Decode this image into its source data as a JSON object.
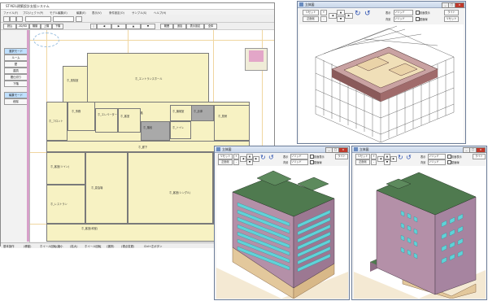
{
  "main": {
    "title": "ST-N2L建築設計支援システム",
    "menu": [
      "ファイル(F)",
      "プロジェクト(P)",
      "モデル編集(E)",
      "編集(E)",
      "表示(V)",
      "条件設定(O)",
      "サンプル(S)",
      "ヘルプ(H)"
    ],
    "toolbar2": [
      "読込",
      "2D/3D",
      "階層",
      "上階",
      "下階",
      "|",
      "◀",
      "▶",
      "▲",
      "▼",
      "範囲",
      "追加",
      "表示設定",
      "全体"
    ],
    "side_buttons": [
      "選択モード",
      "ルーム",
      "壁",
      "建具",
      "間仕切り",
      "下階",
      "編集モード",
      "削除"
    ],
    "status": [
      "基本操作",
      "(移動)",
      "ホイール回転(縮小",
      "(拡大)",
      "ホイール回転",
      "(選択)",
      "(視点変更)",
      "Ctrl+左ボタン"
    ],
    "rooms": [
      {
        "label": "ホ_エントランスホール"
      },
      {
        "label": "ホ_風除室"
      },
      {
        "label": "ホ_フロント"
      },
      {
        "label": "ホ_事務"
      },
      {
        "label": "ホ_客室通路"
      },
      {
        "label": "ホ_エレベーター"
      },
      {
        "label": "ホ_客室"
      },
      {
        "label": "ホ_階段"
      },
      {
        "label": "ホ_機械室"
      },
      {
        "label": "ホ_トイレ"
      },
      {
        "label": "ホ_倉庫"
      },
      {
        "label": "ホ_厨房"
      },
      {
        "label": "ホ_廊下"
      },
      {
        "label": "ホ_客室(ツイン)"
      },
      {
        "label": "ホ_レストラン"
      },
      {
        "label": "ホ_宴会場"
      },
      {
        "label": "ホ_客室(シングル)"
      },
      {
        "label": "ホ_洗面所"
      },
      {
        "label": "ホ_客室(和室)"
      },
      {
        "label": "ホ_共用通路"
      },
      {
        "label": "ホ_階段室"
      }
    ]
  },
  "wireframe_window": {
    "title": "立体図",
    "reset": "リセット",
    "orig": "正面化",
    "display_label": "表示",
    "display_value": "ソリッド",
    "bg_label": "背景",
    "bg_value": "ソリッド",
    "check1": "影面表示",
    "check2": "壁面線",
    "light": "ライト",
    "reset2": "リセット"
  },
  "view2_window": {
    "title": "立体図",
    "reset": "リセット",
    "orig": "正面化",
    "display_label": "表示",
    "display_value": "ソリッド",
    "bg_label": "背景",
    "bg_value": "ソリッド",
    "check1": "影面表示",
    "check2": "壁面線",
    "light": "ライト"
  },
  "view3_window": {
    "title": "立体図",
    "reset": "リセット",
    "orig": "正面化",
    "display_label": "表示",
    "display_value": "ソリッド",
    "bg_label": "背景",
    "bg_value": "ソリッド",
    "check1": "影面表示",
    "check2": "壁面線",
    "light": "ライト"
  },
  "colors": {
    "plan_room": "#f7f2c3",
    "wall": "#c9a0c2",
    "glass": "#5fd3d8",
    "roof": "#4f7a4f",
    "base": "#e8cfa6"
  }
}
